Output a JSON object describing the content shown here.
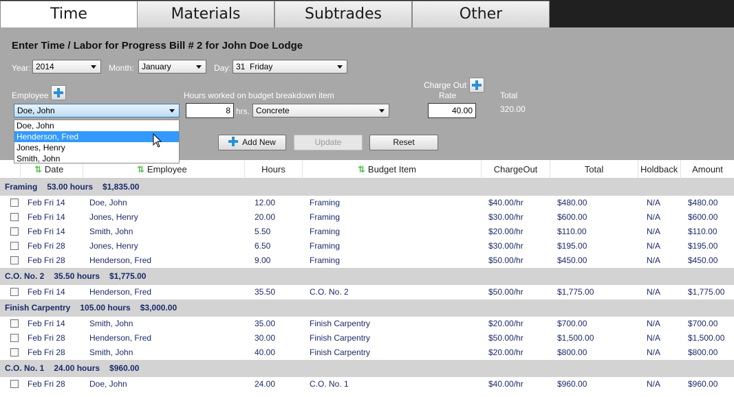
{
  "tabs": [
    {
      "label": "Time",
      "active": true
    },
    {
      "label": "Materials",
      "active": false
    },
    {
      "label": "Subtrades",
      "active": false
    },
    {
      "label": "Other",
      "active": false
    }
  ],
  "form": {
    "title": "Enter Time / Labor for Progress Bill # 2 for John Doe Lodge",
    "year_label": "Year:",
    "year_value": "2014",
    "month_label": "Month:",
    "month_value": "January",
    "day_label": "Day:",
    "day_value": "31  Friday",
    "employee_label": "Employee",
    "employee_value": "Doe, John",
    "hours_label": "Hours worked on budget breakdown item",
    "hours_value": "8",
    "hours_unit": "hrs.",
    "budget_item_value": "Concrete",
    "chargeout_label_1": "Charge Out",
    "chargeout_label_2": "Rate",
    "chargeout_value": "40.00",
    "total_label": "Total",
    "total_value": "320.00",
    "add_new_label": "Add New",
    "update_label": "Update",
    "reset_label": "Reset"
  },
  "employee_dropdown": {
    "options": [
      "Doe, John",
      "Henderson, Fred",
      "Jones, Henry",
      "Smith, John"
    ],
    "highlighted": 1
  },
  "table": {
    "headers": {
      "date": "Date",
      "employee": "Employee",
      "hours": "Hours",
      "budget_item": "Budget Item",
      "chargeout": "ChargeOut",
      "total": "Total",
      "holdback": "Holdback",
      "amount": "Amount"
    },
    "groups": [
      {
        "name": "Framing",
        "hours": "53.00 hours",
        "amount": "$1,835.00",
        "rows": [
          {
            "date": "Feb Fri 14",
            "employee": "Doe, John",
            "hours": "12.00",
            "item": "Framing",
            "chargeout": "$40.00/hr",
            "total": "$480.00",
            "holdback": "N/A",
            "amount": "$480.00"
          },
          {
            "date": "Feb Fri 14",
            "employee": "Jones, Henry",
            "hours": "20.00",
            "item": "Framing",
            "chargeout": "$30.00/hr",
            "total": "$600.00",
            "holdback": "N/A",
            "amount": "$600.00"
          },
          {
            "date": "Feb Fri 14",
            "employee": "Smith, John",
            "hours": "5.50",
            "item": "Framing",
            "chargeout": "$20.00/hr",
            "total": "$110.00",
            "holdback": "N/A",
            "amount": "$110.00"
          },
          {
            "date": "Feb Fri 28",
            "employee": "Jones, Henry",
            "hours": "6.50",
            "item": "Framing",
            "chargeout": "$30.00/hr",
            "total": "$195.00",
            "holdback": "N/A",
            "amount": "$195.00"
          },
          {
            "date": "Feb Fri 28",
            "employee": "Henderson, Fred",
            "hours": "9.00",
            "item": "Framing",
            "chargeout": "$50.00/hr",
            "total": "$450.00",
            "holdback": "N/A",
            "amount": "$450.00"
          }
        ]
      },
      {
        "name": "C.O. No. 2",
        "hours": "35.50 hours",
        "amount": "$1,775.00",
        "rows": [
          {
            "date": "Feb Fri 14",
            "employee": "Henderson, Fred",
            "hours": "35.50",
            "item": "C.O. No. 2",
            "chargeout": "$50.00/hr",
            "total": "$1,775.00",
            "holdback": "N/A",
            "amount": "$1,775.00"
          }
        ]
      },
      {
        "name": "Finish Carpentry",
        "hours": "105.00 hours",
        "amount": "$3,000.00",
        "rows": [
          {
            "date": "Feb Fri 14",
            "employee": "Smith, John",
            "hours": "35.00",
            "item": "Finish Carpentry",
            "chargeout": "$20.00/hr",
            "total": "$700.00",
            "holdback": "N/A",
            "amount": "$700.00"
          },
          {
            "date": "Feb Fri 28",
            "employee": "Henderson, Fred",
            "hours": "30.00",
            "item": "Finish Carpentry",
            "chargeout": "$50.00/hr",
            "total": "$1,500.00",
            "holdback": "N/A",
            "amount": "$1,500.00"
          },
          {
            "date": "Feb Fri 28",
            "employee": "Smith, John",
            "hours": "40.00",
            "item": "Finish Carpentry",
            "chargeout": "$20.00/hr",
            "total": "$800.00",
            "holdback": "N/A",
            "amount": "$800.00"
          }
        ]
      },
      {
        "name": "C.O. No. 1",
        "hours": "24.00 hours",
        "amount": "$960.00",
        "rows": [
          {
            "date": "Feb Fri 28",
            "employee": "Doe, John",
            "hours": "24.00",
            "item": "C.O. No. 1",
            "chargeout": "$40.00/hr",
            "total": "$960.00",
            "holdback": "N/A",
            "amount": "$960.00"
          }
        ]
      }
    ]
  },
  "colors": {
    "tab_bar": "#202020",
    "panel": "#a8a8a8",
    "group_header": "#d3d3d3",
    "row_text": "#1a2a6a",
    "sort_arrow": "#4cc040",
    "plus_icon": "#2a90d8",
    "dropdown_highlight": "#3399ff"
  }
}
